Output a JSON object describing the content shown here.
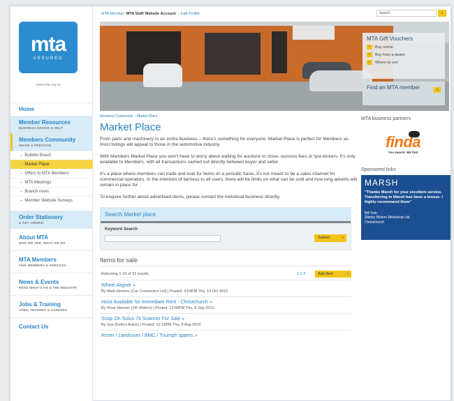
{
  "logo": {
    "mark": "mta",
    "sub": "ASSURED",
    "link": "www.mta.org.nz"
  },
  "nav": [
    {
      "title": "Home",
      "subtitle": "",
      "style": "plain"
    },
    {
      "title": "Member Resources",
      "subtitle": "BUSINESS DEVICE & HELP",
      "style": "blue"
    },
    {
      "title": "Members Community",
      "subtitle": "IMAGE & PRESTIGE",
      "style": "active",
      "children": [
        {
          "label": "Bulletin Board",
          "selected": false
        },
        {
          "label": "Market Place",
          "selected": true
        },
        {
          "label": "Offers to MTA Members",
          "selected": false
        },
        {
          "label": "MTA Meetings",
          "selected": false
        },
        {
          "label": "Branch news",
          "selected": false
        },
        {
          "label": "Member Website Surveys",
          "selected": false
        }
      ]
    },
    {
      "title": "Order Stationery",
      "subtitle": "& GET VIEWED",
      "style": "blue"
    },
    {
      "title": "About MTA",
      "subtitle": "WHO WE ARE, WHAT WE DO",
      "style": "plain"
    },
    {
      "title": "MTA Members",
      "subtitle": "FIND MEMBERS & SERVICES",
      "style": "plain"
    },
    {
      "title": "News & Events",
      "subtitle": "READ WHAT'S ON & THE INDUSTRY",
      "style": "plain"
    },
    {
      "title": "Jobs & Training",
      "subtitle": "JOBS, TRAINING & CAREERS",
      "style": "plain"
    },
    {
      "title": "Contact Us",
      "subtitle": "",
      "style": "plain"
    }
  ],
  "topbar": {
    "member_label": "MTA Member:",
    "account": "MTA Staff Website Account",
    "edit": "Edit Profile",
    "search_placeholder": "Search",
    "search_btn": "»"
  },
  "hero": {
    "gift_title": "MTA Gift Vouchers",
    "gift_links": [
      "Buy online",
      "Buy from a dealer",
      "Where to use"
    ],
    "find_member": "Find an MTA member",
    "arrow": "»"
  },
  "breadcrumb": [
    "Members Community",
    "Market Place"
  ],
  "page_title": "Market Place",
  "paragraphs": [
    "From parts and machinery to an entire business – there's something for everyone. Market Place is perfect for Members as most listings will appeal to those in the automotive industry.",
    "With Members Market Place you won't have to worry about waiting for auctions to close, success fees or tyre-kickers. It's only available to Members, with all transactions carried out directly between buyer and seller.",
    "It's a place where members can trade and look for items on a periodic basis, it's not meant to be a sales channel for commercial operators. In the interests of fairness to all users, there will be limits on what can be sold and how long adverts will remain in place for.",
    "To enquire further about advertised items, please contact the individual business directly."
  ],
  "search": {
    "heading": "Search Market place",
    "keyword_label": "Keyword Search",
    "submit": "Submit",
    "arrow": "»"
  },
  "items": {
    "heading": "Items for sale",
    "results": "Returning 1-10 of 32 results",
    "pager": "1 2 3",
    "add_item": "Add Item",
    "arrow": "»",
    "listings": [
      {
        "title": "Wheel Aligner »",
        "meta": "By Mark Hemmo (Car Connection Ltd) | Posted: 4:03PM Thu, 14 Oct 2010"
      },
      {
        "title": "Hoist Available for Immediate Rent - Christchurch »",
        "meta": "By Rose Hansen (OK Motors) | Posted: 12:40PM Thu, 9 Sep 2010"
      },
      {
        "title": "Snap On Solus 74 Scanner For Sale »",
        "meta": "By Sue (Kelly's Autos) | Posted: 12:19PM Thu, 5 Aug 2010"
      },
      {
        "title": "Rover / Landrover / BMC / Triumph spares »",
        "meta": ""
      }
    ]
  },
  "right": {
    "partners": "MTA business partners",
    "finda_word": "finda",
    "finda_tag": "You search. We find",
    "sponsored": "Sponsored links",
    "marsh_brand": "MARSH",
    "marsh_quote": "\"Thanks Marsh for your excellent service. Transferring to Marsh has been a breeze. I highly recommend them\"",
    "marsh_by": "Bill York\nShirley Motors Workshop Ltd,\nChristchurch"
  }
}
